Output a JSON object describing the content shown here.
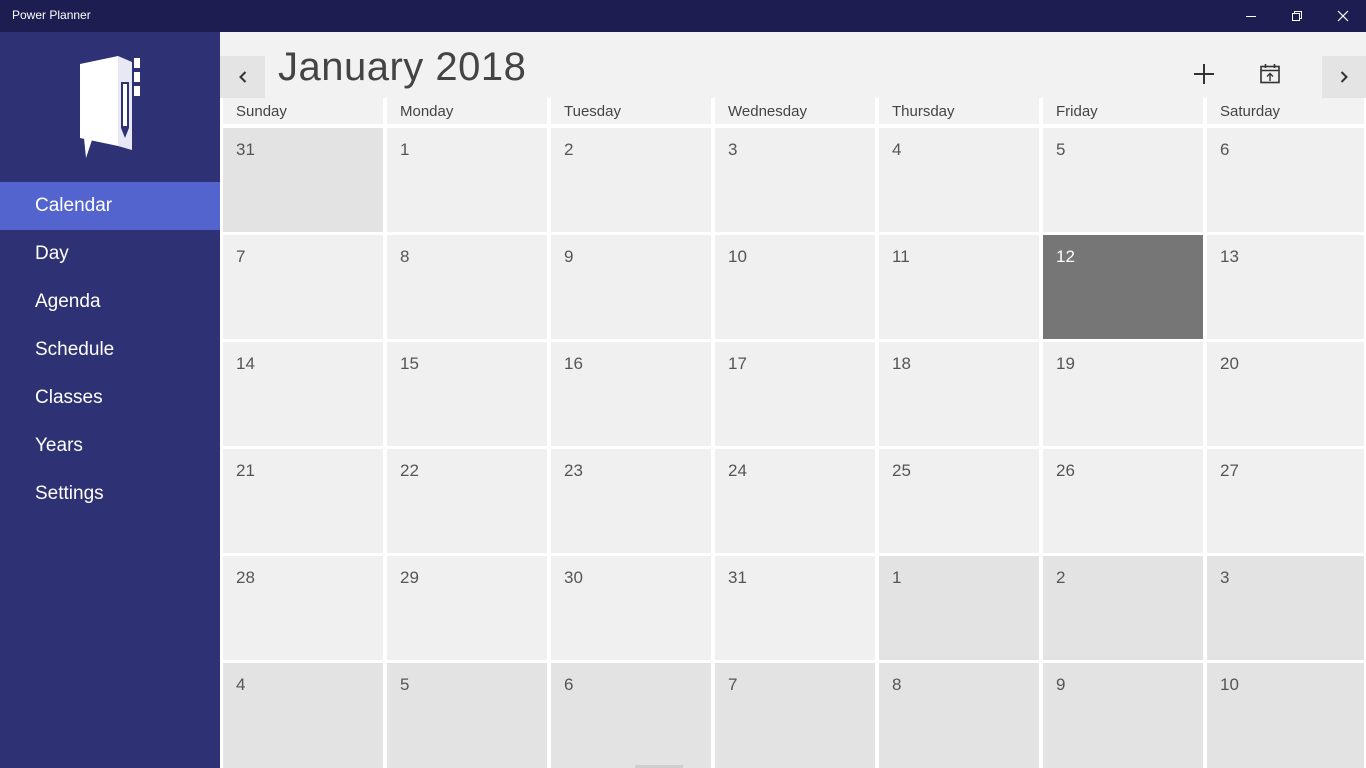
{
  "window": {
    "title": "Power Planner"
  },
  "sidebar": {
    "items": [
      {
        "label": "Calendar",
        "active": true
      },
      {
        "label": "Day"
      },
      {
        "label": "Agenda"
      },
      {
        "label": "Schedule"
      },
      {
        "label": "Classes"
      },
      {
        "label": "Years"
      },
      {
        "label": "Settings"
      }
    ]
  },
  "calendar": {
    "month_title": "January 2018",
    "weekdays": [
      "Sunday",
      "Monday",
      "Tuesday",
      "Wednesday",
      "Thursday",
      "Friday",
      "Saturday"
    ],
    "weeks": [
      [
        "31",
        "1",
        "2",
        "3",
        "4",
        "5",
        "6"
      ],
      [
        "7",
        "8",
        "9",
        "10",
        "11",
        "12",
        "13"
      ],
      [
        "14",
        "15",
        "16",
        "17",
        "18",
        "19",
        "20"
      ],
      [
        "21",
        "22",
        "23",
        "24",
        "25",
        "26",
        "27"
      ],
      [
        "28",
        "29",
        "30",
        "31",
        "1",
        "2",
        "3"
      ],
      [
        "4",
        "5",
        "6",
        "7",
        "8",
        "9",
        "10"
      ]
    ],
    "today": "12",
    "colors": {
      "sidebar": "#2e3173",
      "active_nav": "#5464cf",
      "titlebar": "#1d1d52",
      "day_cell": "#f0f0f0",
      "other_month_cell": "#e3e3e3",
      "today_cell": "#767676"
    }
  },
  "icons": {
    "logo": "notebook-pencil-logo",
    "prev": "chevron-left-icon",
    "next": "chevron-right-icon",
    "add": "plus-icon",
    "today": "calendar-today-icon",
    "minimize": "minimize-icon",
    "maximize": "restore-icon",
    "close": "close-icon"
  }
}
